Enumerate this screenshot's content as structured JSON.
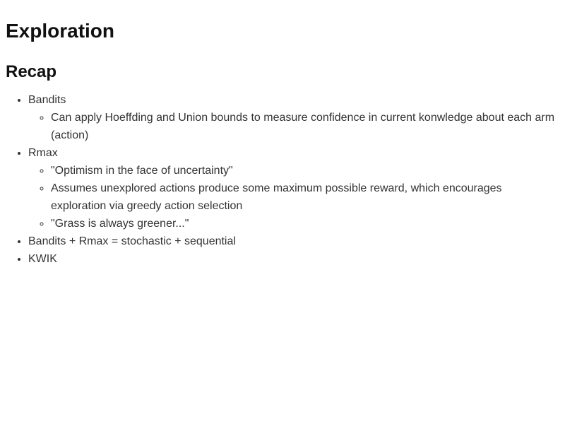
{
  "page": {
    "title": "Exploration",
    "section_heading": "Recap"
  },
  "recap": {
    "items": [
      {
        "label": "Bandits",
        "children": [
          "Can apply Hoeffding and Union bounds to measure confidence in current konwledge about each arm (action)"
        ]
      },
      {
        "label": "Rmax",
        "children": [
          "\"Optimism in the face of uncertainty\"",
          "Assumes unexplored actions produce some maximum possible reward, which encourages exploration via greedy action selection",
          "\"Grass is always greener...\""
        ]
      },
      {
        "label": "Bandits + Rmax = stochastic + sequential",
        "children": []
      },
      {
        "label": "KWIK",
        "children": []
      }
    ]
  }
}
